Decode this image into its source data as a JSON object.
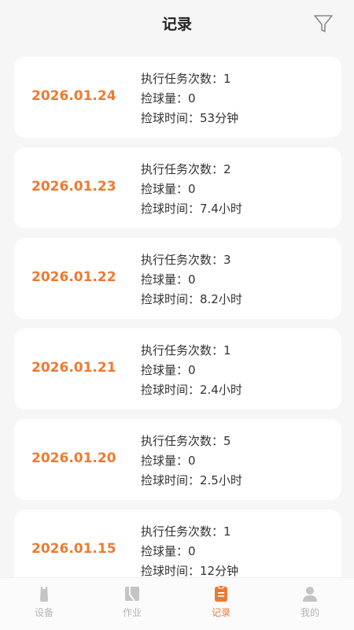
{
  "header": {
    "title": "记录",
    "filter_icon": "filter-icon"
  },
  "records": [
    {
      "date": "2026.01.24",
      "tasks": "执行任务次数：1",
      "balls": "捡球量：0",
      "time": "捡球时间：53分钟"
    },
    {
      "date": "2026.01.23",
      "tasks": "执行任务次数：2",
      "balls": "捡球量：0",
      "time": "捡球时间：7.4小时"
    },
    {
      "date": "2026.01.22",
      "tasks": "执行任务次数：3",
      "balls": "捡球量：0",
      "time": "捡球时间：8.2小时"
    },
    {
      "date": "2026.01.21",
      "tasks": "执行任务次数：1",
      "balls": "捡球量：0",
      "time": "捡球时间：2.4小时"
    },
    {
      "date": "2026.01.20",
      "tasks": "执行任务次数：5",
      "balls": "捡球量：0",
      "time": "捡球时间：2.5小时"
    },
    {
      "date": "2026.01.15",
      "tasks": "执行任务次数：1",
      "balls": "捡球量：0",
      "time": "捡球时间：12分钟"
    }
  ],
  "tabbar": {
    "items": [
      {
        "label": "设备",
        "icon": "device-icon",
        "active": false
      },
      {
        "label": "作业",
        "icon": "work-icon",
        "active": false
      },
      {
        "label": "记录",
        "icon": "records-icon",
        "active": true
      },
      {
        "label": "我的",
        "icon": "profile-icon",
        "active": false
      }
    ]
  },
  "colors": {
    "accent": "#ee7a30",
    "inactive": "#b5b5b5",
    "background": "#f6f6f6"
  }
}
